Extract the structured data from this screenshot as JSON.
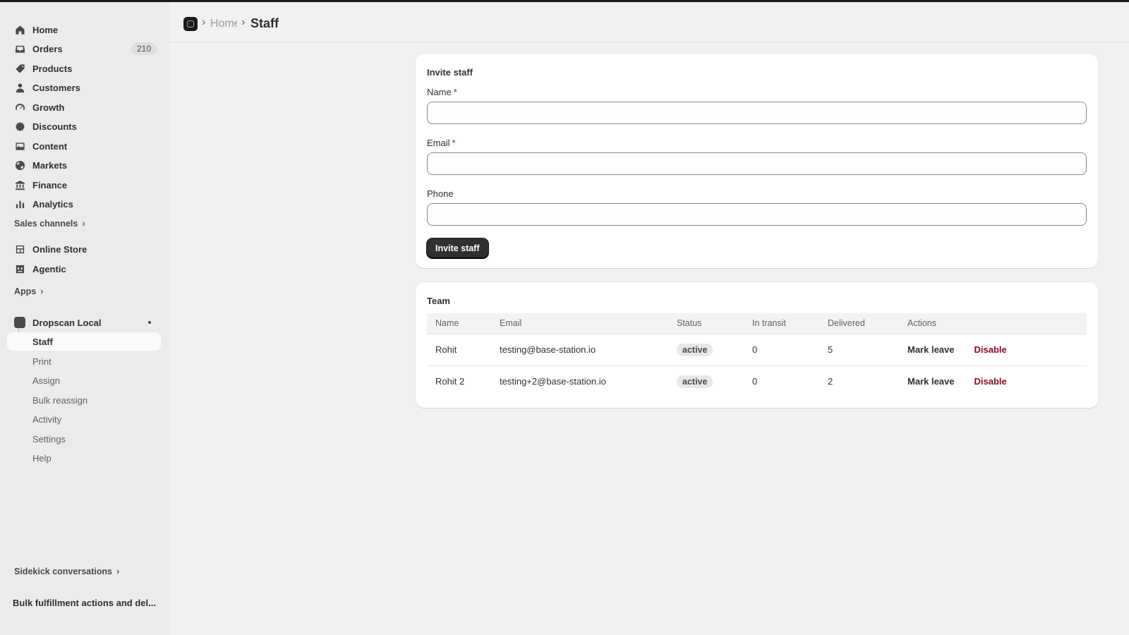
{
  "sidebar": {
    "items": [
      {
        "label": "Home",
        "icon": "home-icon"
      },
      {
        "label": "Orders",
        "icon": "inbox-icon",
        "badge": "210"
      },
      {
        "label": "Products",
        "icon": "tag-icon"
      },
      {
        "label": "Customers",
        "icon": "person-icon"
      },
      {
        "label": "Growth",
        "icon": "gauge-icon"
      },
      {
        "label": "Discounts",
        "icon": "discount-icon"
      },
      {
        "label": "Content",
        "icon": "image-icon"
      },
      {
        "label": "Markets",
        "icon": "globe-icon"
      },
      {
        "label": "Finance",
        "icon": "bank-icon"
      },
      {
        "label": "Analytics",
        "icon": "bar-chart-icon"
      }
    ],
    "sales_channels_label": "Sales channels",
    "channels": [
      {
        "label": "Online Store",
        "icon": "store-icon"
      },
      {
        "label": "Agentic",
        "icon": "robot-icon"
      }
    ],
    "apps_label": "Apps",
    "app": {
      "label": "Dropscan Local",
      "sub_items": [
        "Staff",
        "Print",
        "Assign",
        "Bulk reassign",
        "Activity",
        "Settings",
        "Help"
      ]
    },
    "sidekick_label": "Sidekick conversations",
    "sidekick_item": "Bulk fulfillment actions and del..."
  },
  "header": {
    "breadcrumb_home": "Home",
    "title": "Staff"
  },
  "invite": {
    "title": "Invite staff",
    "name_label": "Name",
    "email_label": "Email",
    "phone_label": "Phone",
    "required_mark": "*",
    "name_value": "",
    "email_value": "",
    "phone_value": "",
    "submit_label": "Invite staff"
  },
  "team": {
    "title": "Team",
    "columns": [
      "Name",
      "Email",
      "Status",
      "In transit",
      "Delivered",
      "Actions"
    ],
    "rows": [
      {
        "name": "Rohit",
        "email": "testing@base-station.io",
        "status": "active",
        "in_transit": "0",
        "delivered": "5",
        "action_leave": "Mark leave",
        "action_disable": "Disable"
      },
      {
        "name": "Rohit 2",
        "email": "testing+2@base-station.io",
        "status": "active",
        "in_transit": "0",
        "delivered": "2",
        "action_leave": "Mark leave",
        "action_disable": "Disable"
      }
    ]
  },
  "colors": {
    "primary_button": "#303030",
    "danger_text": "#8e0b21",
    "required": "#c70a24",
    "sidebar_bg": "#ebebeb",
    "page_bg": "#f1f1f1"
  }
}
